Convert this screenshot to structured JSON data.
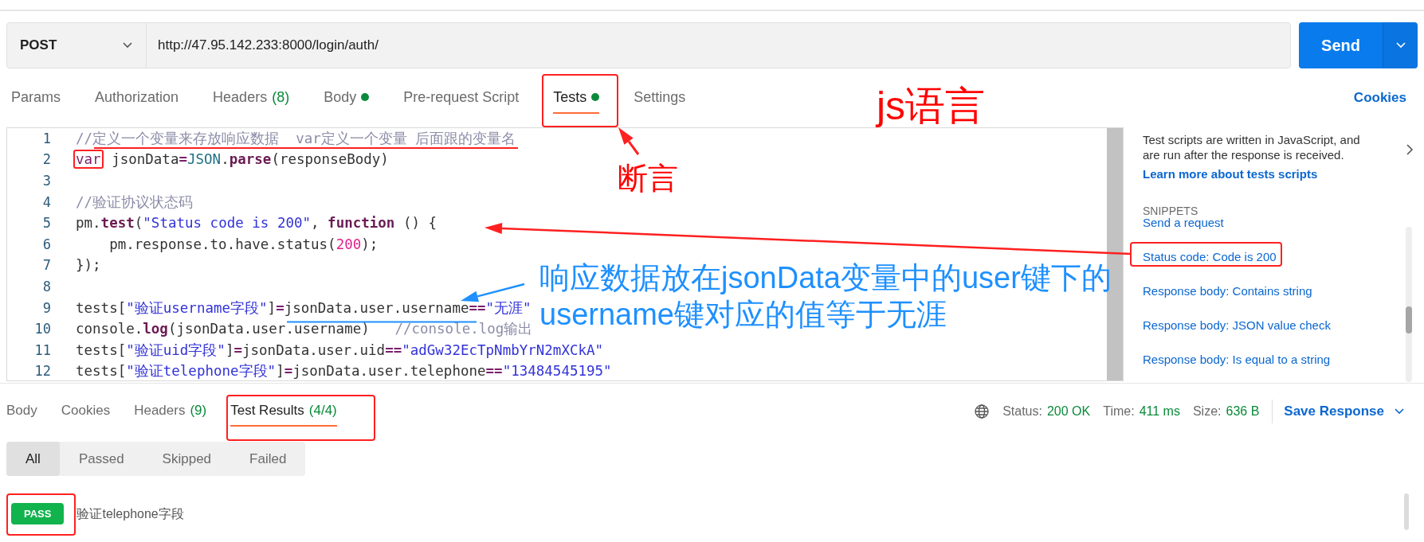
{
  "request": {
    "method": "POST",
    "url": "http://47.95.142.233:8000/login/auth/",
    "send": "Send"
  },
  "request_tabs": [
    {
      "label": "Params",
      "selected": false,
      "dot": false
    },
    {
      "label": "Authorization",
      "selected": false,
      "dot": false
    },
    {
      "label": "Headers",
      "count": "(8)",
      "selected": false,
      "dot": false
    },
    {
      "label": "Body",
      "selected": false,
      "dot": true
    },
    {
      "label": "Pre-request Script",
      "selected": false,
      "dot": false
    },
    {
      "label": "Tests",
      "selected": true,
      "dot": true
    },
    {
      "label": "Settings",
      "selected": false,
      "dot": false
    }
  ],
  "cookies_link": "Cookies",
  "editor": {
    "lines": [
      {
        "number": "1",
        "tokens": [
          {
            "t": "//定义一个变量来存放响应数据  var定义一个变量 后面跟的变量名",
            "kind": "comment"
          }
        ]
      },
      {
        "number": "2",
        "tokens": [
          {
            "t": "var",
            "kind": "keyword",
            "framed": true
          },
          {
            "t": " jsonData",
            "kind": "plain"
          },
          {
            "t": "=",
            "kind": "op"
          },
          {
            "t": "JSON",
            "kind": "builtin"
          },
          {
            "t": ".",
            "kind": "plain"
          },
          {
            "t": "parse",
            "kind": "fn"
          },
          {
            "t": "(responseBody)",
            "kind": "plain"
          }
        ]
      },
      {
        "number": "3"
      },
      {
        "number": "4",
        "tokens": [
          {
            "t": "//验证协议状态码",
            "kind": "comment"
          }
        ]
      },
      {
        "number": "5",
        "tokens": [
          {
            "t": "pm.",
            "kind": "plain"
          },
          {
            "t": "test",
            "kind": "fn"
          },
          {
            "t": "(",
            "kind": "plain"
          },
          {
            "t": "\"Status code is 200\"",
            "kind": "string"
          },
          {
            "t": ", ",
            "kind": "plain"
          },
          {
            "t": "function",
            "kind": "fn"
          },
          {
            "t": " () {",
            "kind": "plain"
          }
        ]
      },
      {
        "number": "6",
        "tokens": [
          {
            "t": "    pm.response.to.have.status(",
            "kind": "plain"
          },
          {
            "t": "200",
            "kind": "number"
          },
          {
            "t": ");",
            "kind": "plain"
          }
        ]
      },
      {
        "number": "7",
        "tokens": [
          {
            "t": "});",
            "kind": "plain"
          }
        ]
      },
      {
        "number": "8"
      },
      {
        "number": "9",
        "tokens": [
          {
            "t": "tests[",
            "kind": "plain"
          },
          {
            "t": "\"验证username字段\"",
            "kind": "string"
          },
          {
            "t": "]",
            "kind": "plain"
          },
          {
            "t": "=",
            "kind": "op"
          },
          {
            "t": "jsonData.user.username",
            "kind": "plain"
          },
          {
            "t": "==",
            "kind": "op"
          },
          {
            "t": "\"无涯\"",
            "kind": "string"
          }
        ]
      },
      {
        "number": "10",
        "tokens": [
          {
            "t": "console.",
            "kind": "plain"
          },
          {
            "t": "log",
            "kind": "fn"
          },
          {
            "t": "(jsonData.user.username)   ",
            "kind": "plain"
          },
          {
            "t": "//console.log输出",
            "kind": "comment"
          }
        ]
      },
      {
        "number": "11",
        "tokens": [
          {
            "t": "tests[",
            "kind": "plain"
          },
          {
            "t": "\"验证uid字段\"",
            "kind": "string"
          },
          {
            "t": "]",
            "kind": "plain"
          },
          {
            "t": "=",
            "kind": "op"
          },
          {
            "t": "jsonData.user.uid",
            "kind": "plain"
          },
          {
            "t": "==",
            "kind": "op"
          },
          {
            "t": "\"adGw32EcTpNmbYrN2mXCkA\"",
            "kind": "string"
          }
        ]
      },
      {
        "number": "12",
        "tokens": [
          {
            "t": "tests[",
            "kind": "plain"
          },
          {
            "t": "\"验证telephone字段\"",
            "kind": "string"
          },
          {
            "t": "]",
            "kind": "plain"
          },
          {
            "t": "=",
            "kind": "op"
          },
          {
            "t": "jsonData.user.telephone",
            "kind": "plain"
          },
          {
            "t": "==",
            "kind": "op"
          },
          {
            "t": "\"13484545195\"",
            "kind": "string"
          }
        ]
      }
    ]
  },
  "sidebar": {
    "description": "Test scripts are written in JavaScript, and are run after the response is received.",
    "link": "Learn more about tests scripts",
    "snippets_heading": "SNIPPETS",
    "snippets": [
      "Send a request",
      "Status code: Code is 200",
      "Response body: Contains string",
      "Response body: JSON value check",
      "Response body: Is equal to a string"
    ]
  },
  "response": {
    "tabs": [
      {
        "label": "Body",
        "selected": false
      },
      {
        "label": "Cookies",
        "selected": false
      },
      {
        "label": "Headers",
        "count": "(9)",
        "selected": false
      },
      {
        "label": "Test Results",
        "count": "(4/4)",
        "selected": true
      }
    ],
    "status_label": "Status:",
    "status": "200 OK",
    "time_label": "Time:",
    "time": "411 ms",
    "size_label": "Size:",
    "size": "636 B",
    "save": "Save Response",
    "filters": [
      {
        "label": "All",
        "selected": true
      },
      {
        "label": "Passed",
        "selected": false
      },
      {
        "label": "Skipped",
        "selected": false
      },
      {
        "label": "Failed",
        "selected": false
      }
    ],
    "results": [
      {
        "status": "PASS",
        "name": "验证telephone字段"
      }
    ]
  },
  "annotations": {
    "texts": [
      {
        "lines": [
          "js语言"
        ],
        "color": "#ff0000"
      },
      {
        "lines": [
          "断言"
        ],
        "color": "#ff0000"
      },
      {
        "lines": [
          "响应数据放在jsonData变量中的user键下的",
          "username键对应的值等于无涯"
        ],
        "color": "#1e90ff"
      }
    ]
  }
}
